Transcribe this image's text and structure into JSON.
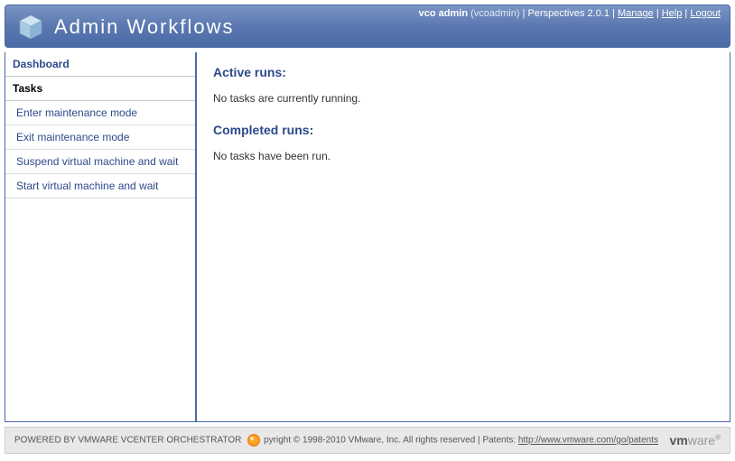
{
  "header": {
    "title": "Admin Workflows",
    "user_display": "vco admin",
    "username_paren": "(vcoadmin)",
    "perspectives": "Perspectives 2.0.1",
    "manage": "Manage",
    "help": "Help",
    "logout": "Logout"
  },
  "sidebar": {
    "dashboard": "Dashboard",
    "tasks_header": "Tasks",
    "items": [
      {
        "label": "Enter maintenance mode"
      },
      {
        "label": "Exit maintenance mode"
      },
      {
        "label": "Suspend virtual machine and wait"
      },
      {
        "label": "Start virtual machine and wait"
      }
    ]
  },
  "content": {
    "active_runs_title": "Active runs:",
    "active_runs_msg": "No tasks are currently running.",
    "completed_runs_title": "Completed runs:",
    "completed_runs_msg": "No tasks have been run."
  },
  "footer": {
    "powered": "POWERED BY VMWARE VCENTER ORCHESTRATOR",
    "copyright": "pyright © 1998-2010 VMware, Inc. All rights reserved",
    "patents_label": "Patents:",
    "patents_url": "http://www.vmware.com/go/patents"
  }
}
